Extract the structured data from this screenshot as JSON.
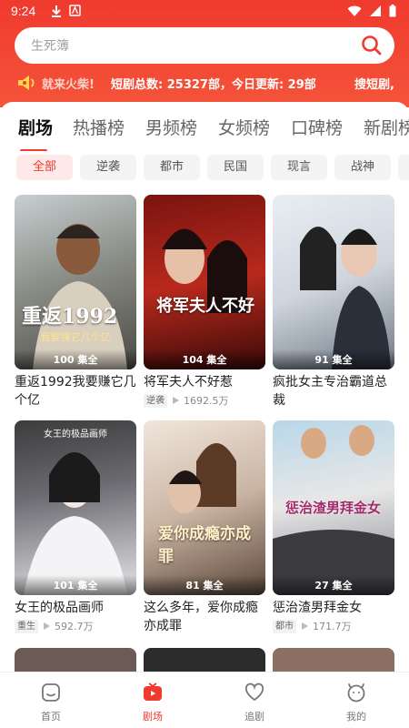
{
  "status": {
    "time": "9:24"
  },
  "search": {
    "placeholder": "生死簿"
  },
  "ticker": {
    "fade_text": "就来火柴!",
    "stats": "短剧总数: 25327部，今日更新: 29部",
    "right_text": "搜短剧,"
  },
  "tabs": [
    {
      "label": "剧场",
      "active": true
    },
    {
      "label": "热播榜"
    },
    {
      "label": "男频榜"
    },
    {
      "label": "女频榜"
    },
    {
      "label": "口碑榜"
    },
    {
      "label": "新剧榜"
    }
  ],
  "chips": [
    {
      "label": "全部",
      "active": true
    },
    {
      "label": "逆袭"
    },
    {
      "label": "都市"
    },
    {
      "label": "民国"
    },
    {
      "label": "现言"
    },
    {
      "label": "战神"
    }
  ],
  "cards": [
    {
      "title": "重返1992我要赚它几个亿",
      "episodes": "100 集全",
      "poster_caption": "重返1992",
      "poster_sub": "我要赚它几个亿",
      "tag": "",
      "views": ""
    },
    {
      "title": "将军夫人不好惹",
      "episodes": "104 集全",
      "poster_caption": "将军夫人不好",
      "poster_sub": "",
      "tag": "逆袭",
      "views": "1692.5万"
    },
    {
      "title": "疯批女主专治霸道总裁",
      "episodes": "91 集全",
      "poster_caption": "",
      "poster_sub": "",
      "tag": "",
      "views": ""
    },
    {
      "title": "女王的极品画师",
      "episodes": "101 集全",
      "poster_caption": "",
      "poster_sub": "女王的极品画师",
      "tag": "重生",
      "views": "592.7万"
    },
    {
      "title": "这么多年，爱你成瘾亦成罪",
      "episodes": "81 集全",
      "poster_caption": "爱你成瘾亦成罪",
      "poster_sub": "",
      "tag": "",
      "views": ""
    },
    {
      "title": "惩治渣男拜金女",
      "episodes": "27 集全",
      "poster_caption": "惩治渣男拜金女",
      "poster_sub": "",
      "tag": "都市",
      "views": "171.7万"
    }
  ],
  "nav": [
    {
      "label": "首页",
      "icon": "home-icon"
    },
    {
      "label": "剧场",
      "icon": "theater-icon",
      "active": true
    },
    {
      "label": "追剧",
      "icon": "heart-icon"
    },
    {
      "label": "我的",
      "icon": "profile-icon"
    }
  ],
  "colors": {
    "accent": "#ef3a2e",
    "header_top": "#ef3a2e",
    "header_bottom": "#f5543a"
  }
}
